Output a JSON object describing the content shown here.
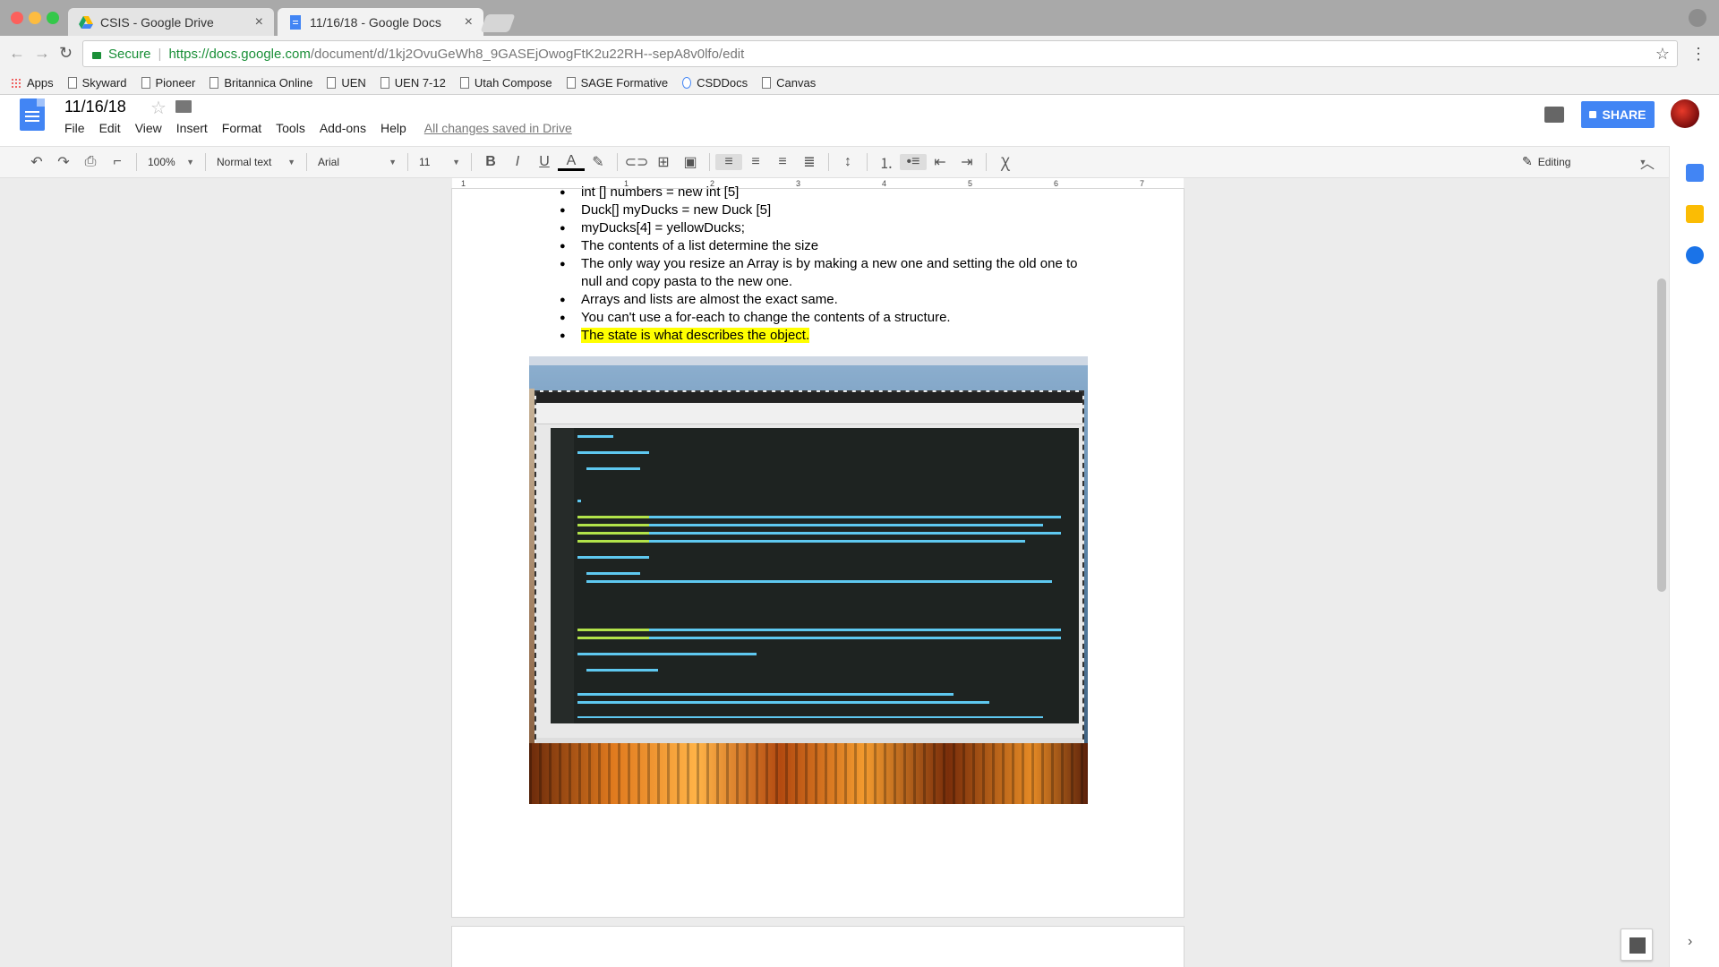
{
  "browser": {
    "tabs": [
      {
        "title": "CSIS - Google Drive",
        "active": false
      },
      {
        "title": "11/16/18 - Google Docs",
        "active": true
      }
    ],
    "address": {
      "secure_label": "Secure",
      "url_host": "https://docs.google.com",
      "url_path": "/document/d/1kj2OvuGeWh8_9GASEjOwogFtK2u22RH--sepA8v0lfo/edit"
    },
    "bookmarks": [
      "Apps",
      "Skyward",
      "Pioneer",
      "Britannica Online",
      "UEN",
      "UEN 7-12",
      "Utah Compose",
      "SAGE Formative",
      "CSDDocs",
      "Canvas"
    ]
  },
  "docs": {
    "title": "11/16/18",
    "menus": [
      "File",
      "Edit",
      "View",
      "Insert",
      "Format",
      "Tools",
      "Add-ons",
      "Help"
    ],
    "saved_status": "All changes saved in Drive",
    "share_label": "SHARE",
    "toolbar": {
      "zoom": "100%",
      "style": "Normal text",
      "font": "Arial",
      "size": "11",
      "mode": "Editing"
    },
    "ruler_ticks": [
      "1",
      "1",
      "2",
      "3",
      "4",
      "5",
      "6",
      "7"
    ],
    "bullets": [
      "int [] numbers = new  int [5]",
      "Duck[] myDucks = new Duck [5]",
      "myDucks[4] = yellowDucks;",
      "The contents of a list determine the size",
      "The only way you resize an Array is by making a new one and setting the old one to null and copy pasta to the new one.",
      "Arrays and lists are almost the exact same.",
      "You can't use a for-each to change the contents of a structure.",
      "The state is what describes the object."
    ],
    "highlight_color": "#ffff00"
  },
  "colors": {
    "share_blue": "#4285f4",
    "secure_green": "#1a8f38"
  }
}
